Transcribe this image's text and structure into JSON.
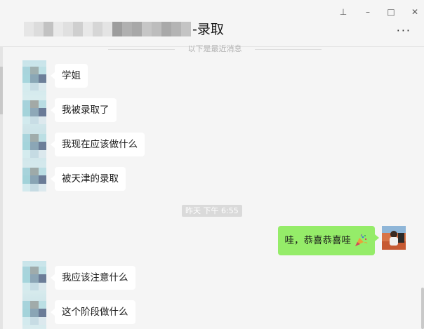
{
  "header": {
    "title_suffix": "-录取",
    "more_label": "···",
    "window_controls": {
      "pin": "⊥",
      "minimize": "–",
      "maximize": "□",
      "close": "✕"
    }
  },
  "notice": {
    "text": "以下是最近消息"
  },
  "messages": [
    {
      "sender": "other",
      "text": "学姐"
    },
    {
      "sender": "other",
      "text": "我被录取了"
    },
    {
      "sender": "other",
      "text": "我现在应该做什么"
    },
    {
      "sender": "other",
      "text": "被天津的录取"
    },
    {
      "sender": "self",
      "text": "哇，恭喜恭喜哇",
      "emoji": "party-popper"
    },
    {
      "sender": "other",
      "text": "我应该注意什么"
    },
    {
      "sender": "other",
      "text": "这个阶段做什么"
    }
  ],
  "timestamp": "昨天 下午 6:55",
  "colors": {
    "background": "#f5f5f5",
    "bubble_other": "#ffffff",
    "bubble_self": "#95ec69",
    "timestamp_bg": "#dadada"
  }
}
